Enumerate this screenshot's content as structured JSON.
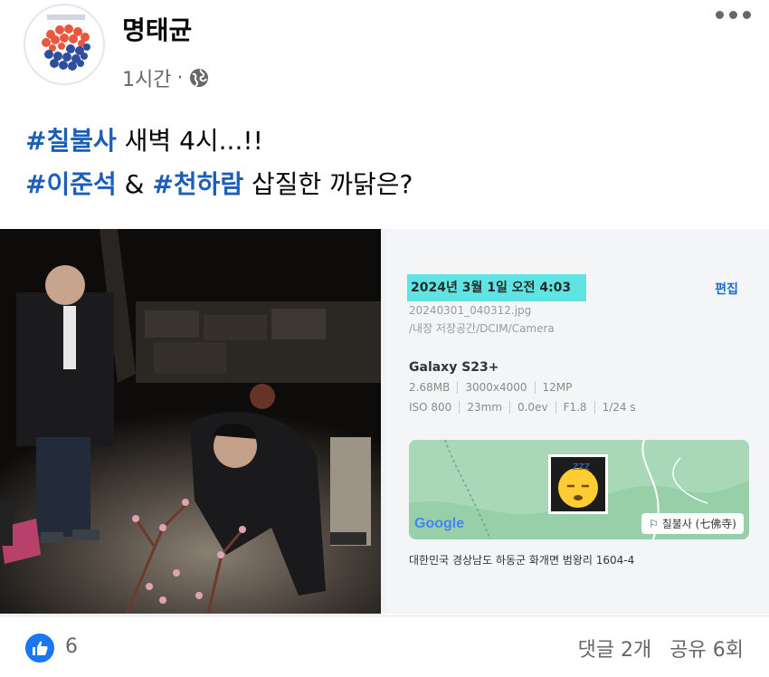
{
  "post": {
    "author": "명태균",
    "time": "1시간",
    "separator": "·",
    "privacy_icon": "globe-icon",
    "more_icon": "more-horizontal-icon",
    "line1": {
      "tag": "#칠불사",
      "text": " 새벽 4시...!!"
    },
    "line2": {
      "tag1": "#이준석",
      "amp": " & ",
      "tag2": "#천하람",
      "text": " 삽질한 까닭은?"
    }
  },
  "photo_info": {
    "date": "2024년 3월 1일 오전 4:03",
    "edit_label": "편집",
    "filename": "20240301_040312.jpg",
    "path": "/내장 저장공간/DCIM/Camera",
    "model": "Galaxy S23+",
    "specs_row1": [
      "2.68MB",
      "3000x4000",
      "12MP"
    ],
    "specs_row2": [
      "ISO 800",
      "23mm",
      "0.0ev",
      "F1.8",
      "1/24 s"
    ],
    "map_logo": "Google",
    "place_label": "칠불사 (七佛寺)",
    "address": "대한민국 경상남도 하동군 화개면 범왕리 1604-4",
    "thumb_text": "zzz"
  },
  "footer": {
    "like_icon": "thumbs-up-icon",
    "like_count": "6",
    "comments": "댓글 2개",
    "shares": "공유 6회"
  },
  "colors": {
    "hashtag": "#1b5fb8",
    "like_blue": "#1877f2",
    "date_highlight": "#5fe3e3",
    "muted": "#65676b"
  }
}
